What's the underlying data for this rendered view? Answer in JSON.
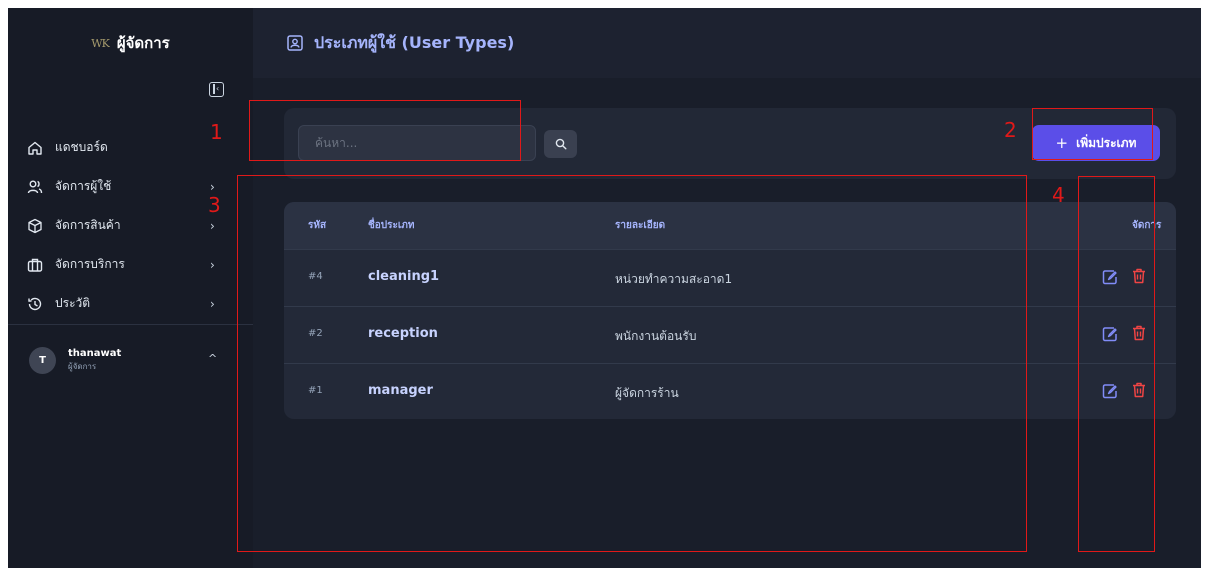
{
  "brand": {
    "logo_text": "WK",
    "title": "ผู้จัดการ"
  },
  "sidebar": {
    "items": [
      {
        "label": "แดชบอร์ด",
        "icon": "home-icon",
        "has_chevron": false
      },
      {
        "label": "จัดการผู้ใช้",
        "icon": "users-icon",
        "has_chevron": true
      },
      {
        "label": "จัดการสินค้า",
        "icon": "box-icon",
        "has_chevron": true
      },
      {
        "label": "จัดการบริการ",
        "icon": "briefcase-icon",
        "has_chevron": true
      },
      {
        "label": "ประวัติ",
        "icon": "history-icon",
        "has_chevron": true
      }
    ],
    "chevron": "›"
  },
  "user": {
    "initial": "T",
    "name": "thanawat",
    "role": "ผู้จัดการ",
    "chevron": "^"
  },
  "header": {
    "title": "ประเภทผู้ใช้ (User Types)",
    "icon": "id-badge-icon"
  },
  "toolbar": {
    "search_placeholder": "ค้นหา...",
    "add_label": "เพิ่มประเภท",
    "add_plus": "+"
  },
  "table": {
    "headers": {
      "id": "รหัส",
      "name": "ชื่อประเภท",
      "desc": "รายละเอียด",
      "actions": "จัดการ"
    },
    "rows": [
      {
        "id": "#4",
        "name": "cleaning1",
        "desc": "หน่วยทำความสะอาด1"
      },
      {
        "id": "#2",
        "name": "reception",
        "desc": "พนักงานต้อนรับ"
      },
      {
        "id": "#1",
        "name": "manager",
        "desc": "ผู้จัดการร้าน"
      }
    ]
  },
  "annotations": [
    "1",
    "2",
    "3",
    "4"
  ],
  "colors": {
    "accent": "#5b4ee8",
    "danger": "#ef4444",
    "edit": "#818cf8",
    "annotation": "#e01919"
  }
}
